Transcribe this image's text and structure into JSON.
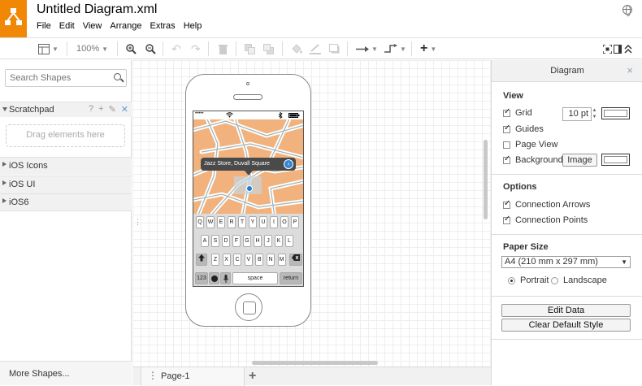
{
  "app": {
    "title": "Untitled Diagram.xml",
    "menu": [
      "File",
      "Edit",
      "View",
      "Arrange",
      "Extras",
      "Help"
    ]
  },
  "toolbar": {
    "zoom": "100%"
  },
  "sidebar": {
    "search_placeholder": "Search Shapes",
    "scratchpad": "Scratchpad",
    "scratchpad_tools": [
      "?",
      "+",
      "✎",
      "✕"
    ],
    "drop_hint": "Drag elements here",
    "libraries": [
      "iOS Icons",
      "iOS UI",
      "iOS6"
    ],
    "more_shapes": "More Shapes..."
  },
  "canvas": {
    "callout": "Jazz Store, Duvall Square",
    "keyboard": {
      "row1": [
        "Q",
        "W",
        "E",
        "R",
        "T",
        "Y",
        "U",
        "I",
        "O",
        "P"
      ],
      "row2": [
        "A",
        "S",
        "D",
        "F",
        "G",
        "H",
        "J",
        "K",
        "L"
      ],
      "row3": [
        "Z",
        "X",
        "C",
        "V",
        "B",
        "N",
        "M"
      ],
      "num_key": "123",
      "space_key": "space",
      "return_key": "return"
    },
    "status_bar": {
      "signal": "•••••"
    }
  },
  "pages": {
    "current": "Page-1"
  },
  "panel": {
    "title": "Diagram",
    "view_title": "View",
    "grid_label": "Grid",
    "grid_size": "10 pt",
    "guides_label": "Guides",
    "page_view_label": "Page View",
    "background_label": "Background",
    "image_button": "Image",
    "options_title": "Options",
    "connection_arrows": "Connection Arrows",
    "connection_points": "Connection Points",
    "paper_size_title": "Paper Size",
    "paper_size_value": "A4 (210 mm x 297 mm)",
    "portrait": "Portrait",
    "landscape": "Landscape",
    "edit_data": "Edit Data",
    "clear_default_style": "Clear Default Style"
  },
  "colors": {
    "logo": "#f08705",
    "map": "#f2b27d",
    "pin": "#1e7bd6"
  }
}
